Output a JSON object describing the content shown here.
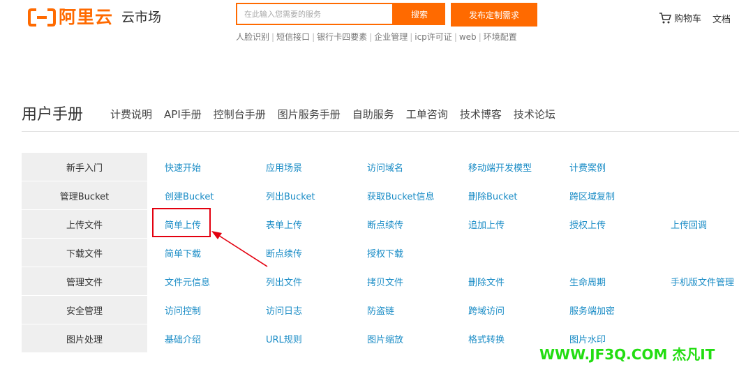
{
  "header": {
    "brand": "阿里云",
    "market": "云市场",
    "search_placeholder": "在此输入您需要的服务",
    "search_button": "搜索",
    "publish_button": "发布定制需求",
    "hot_keywords": [
      "人脸识别",
      "短信接口",
      "银行卡四要素",
      "企业管理",
      "icp许可证",
      "web",
      "环境配置"
    ],
    "cart": "购物车",
    "docs": "文档"
  },
  "manual": {
    "title": "用户手册",
    "nav": [
      "计费说明",
      "API手册",
      "控制台手册",
      "图片服务手册",
      "自助服务",
      "工单咨询",
      "技术博客",
      "技术论坛"
    ]
  },
  "grid": {
    "rows": [
      {
        "header": "新手入门",
        "items": [
          "快速开始",
          "应用场景",
          "访问域名",
          "移动端开发模型",
          "计费案例"
        ]
      },
      {
        "header": "管理Bucket",
        "items": [
          "创建Bucket",
          "列出Bucket",
          "获取Bucket信息",
          "删除Bucket",
          "跨区域复制"
        ]
      },
      {
        "header": "上传文件",
        "items": [
          "简单上传",
          "表单上传",
          "断点续传",
          "追加上传",
          "授权上传",
          "上传回调"
        ]
      },
      {
        "header": "下载文件",
        "items": [
          "简单下载",
          "断点续传",
          "授权下载"
        ]
      },
      {
        "header": "管理文件",
        "items": [
          "文件元信息",
          "列出文件",
          "拷贝文件",
          "删除文件",
          "生命周期",
          "手机版文件管理"
        ]
      },
      {
        "header": "安全管理",
        "items": [
          "访问控制",
          "访问日志",
          "防盗链",
          "跨域访问",
          "服务端加密"
        ]
      },
      {
        "header": "图片处理",
        "items": [
          "基础介绍",
          "URL规则",
          "图片缩放",
          "格式转换",
          "图片水印"
        ]
      }
    ]
  },
  "watermark": "WWW.JF3Q.COM 杰凡IT",
  "colors": {
    "brand_orange": "#ff6a00",
    "link_blue": "#1a8cc6",
    "annotation_red": "#e3000f",
    "watermark_green": "#22dd11"
  }
}
